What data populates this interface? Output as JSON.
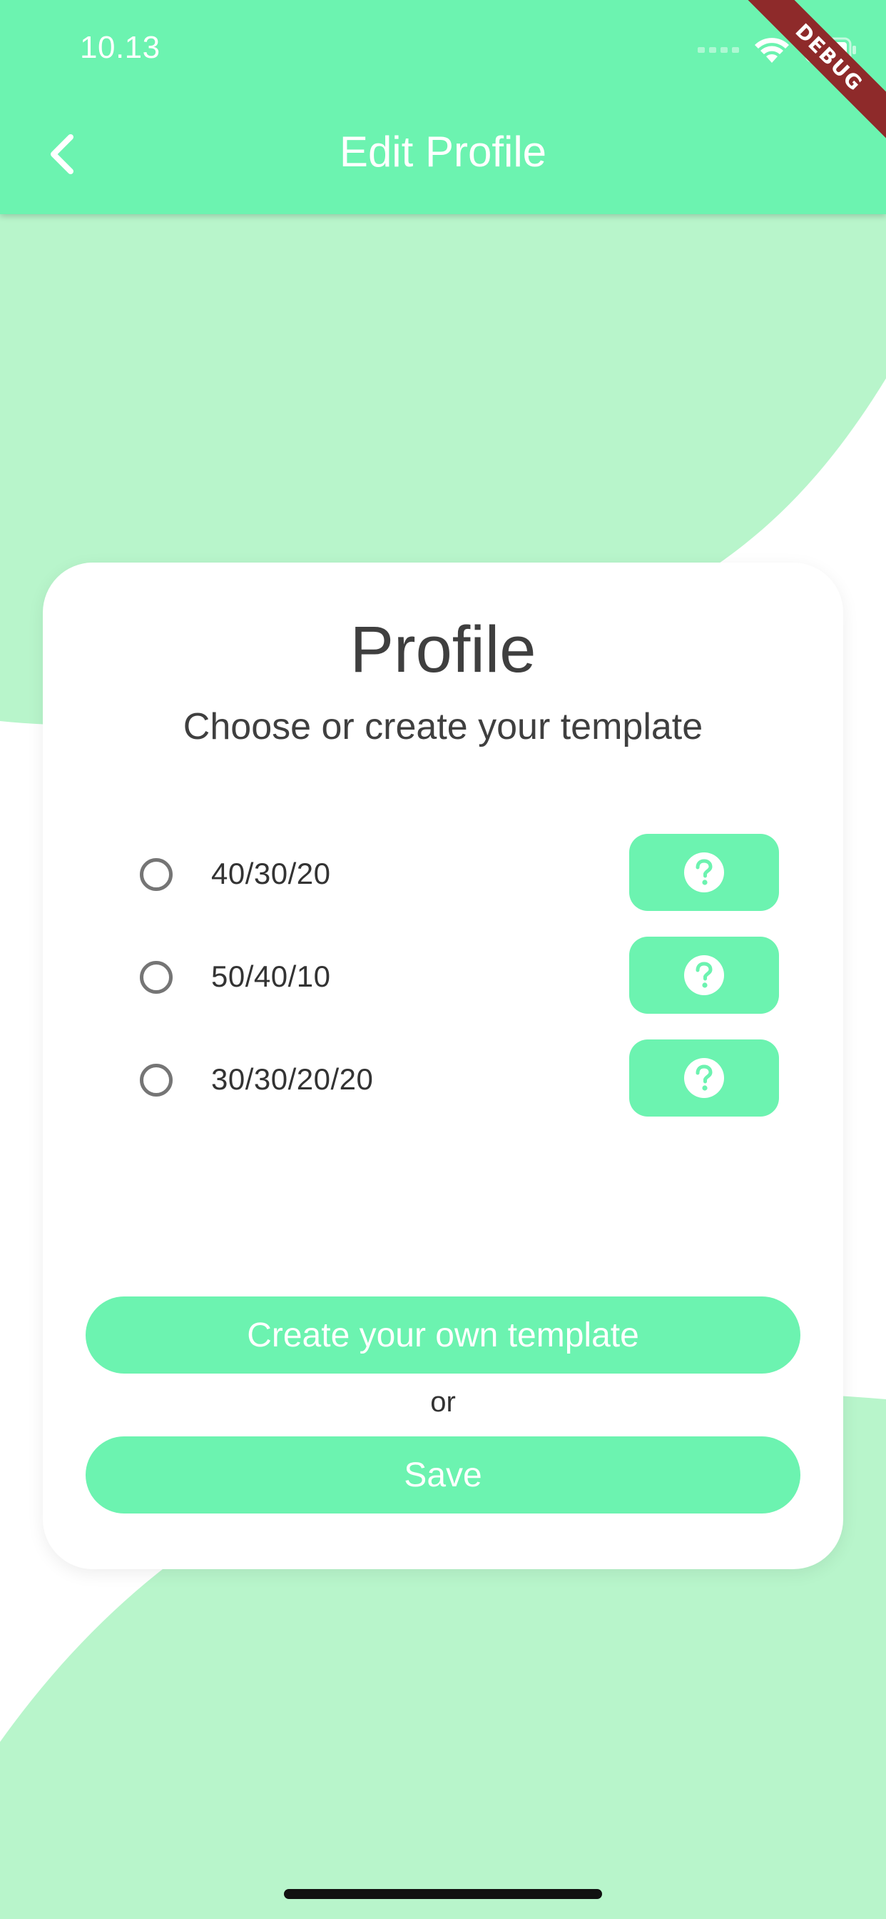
{
  "status_bar": {
    "time": "10.13",
    "debug_label": "DEBUG"
  },
  "app_bar": {
    "title": "Edit Profile",
    "back_icon": "chevron-left-icon"
  },
  "card": {
    "title": "Profile",
    "subtitle": "Choose or create your template",
    "options": [
      {
        "label": "40/30/20",
        "selected": false
      },
      {
        "label": "50/40/10",
        "selected": false
      },
      {
        "label": "30/30/20/20",
        "selected": false
      }
    ],
    "help_icon": "question-circle-icon",
    "create_label": "Create your own template",
    "or_label": "or",
    "save_label": "Save"
  },
  "colors": {
    "primary": "#6cf3b0",
    "background_blob": "#b8f5cb",
    "text": "#3f3f3f",
    "debug_ribbon": "#8e2a2a"
  }
}
